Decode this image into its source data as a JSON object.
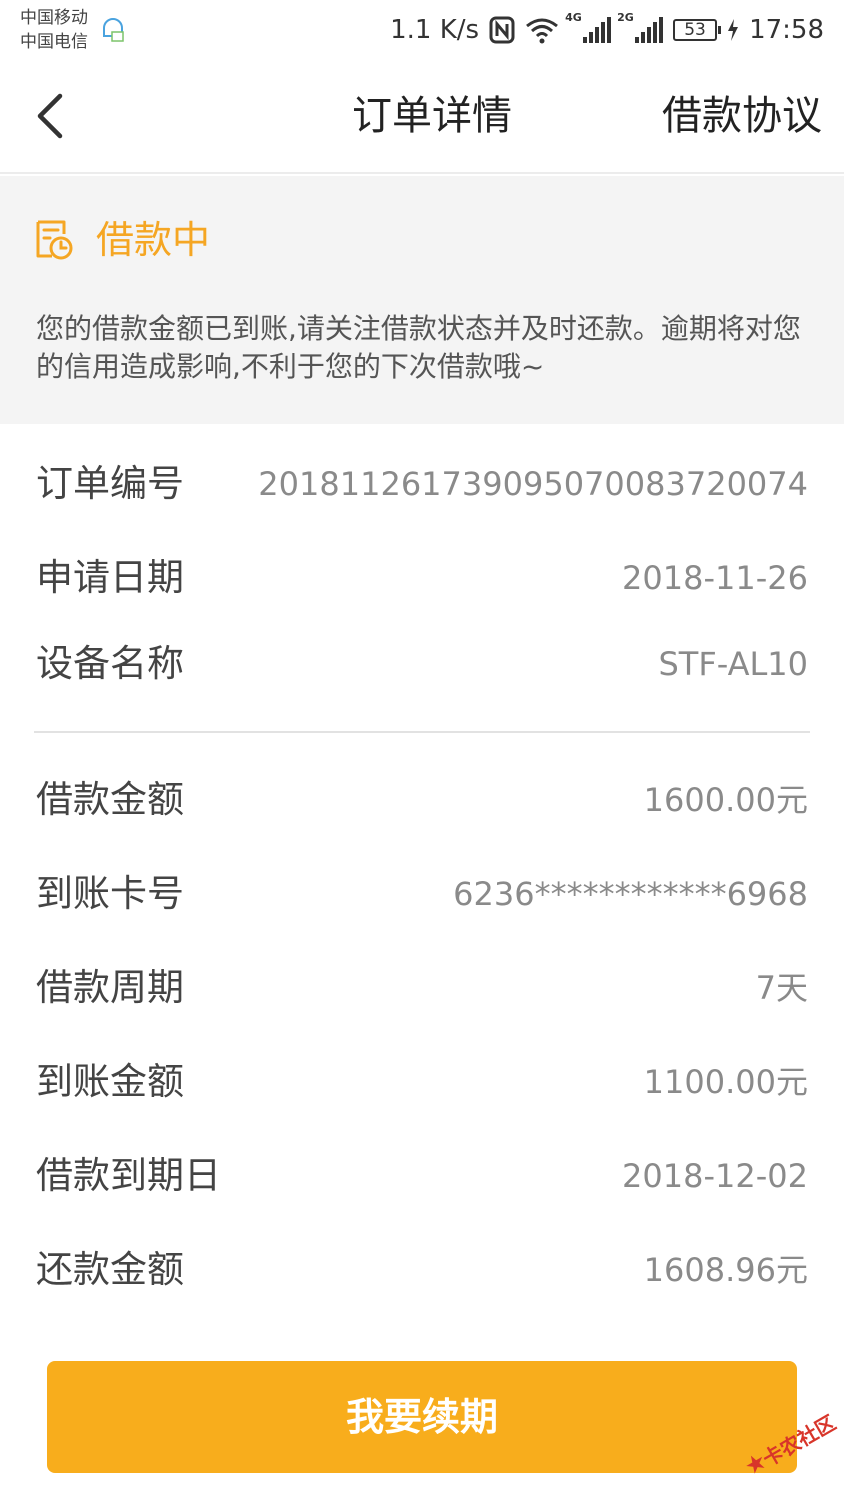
{
  "status_bar": {
    "carrier_1": "中国移动",
    "carrier_2": "中国电信",
    "net_speed": "1.1 K/s",
    "signal_1_tag": "4G",
    "signal_2_tag": "2G",
    "battery": "53",
    "time": "17:58"
  },
  "nav": {
    "title": "订单详情",
    "action": "借款协议"
  },
  "order_status": {
    "label": "借款中",
    "note": "您的借款金额已到账,请关注借款状态并及时还款。逾期将对您的信用造成影响,不利于您的下次借款哦~",
    "accent_color": "#f5a623"
  },
  "details": [
    {
      "label": "订单编号",
      "value": "20181126173909507008372007 4"
    },
    {
      "label": "申请日期",
      "value": "2018-11-26"
    },
    {
      "label": "设备名称",
      "value": "STF-AL10"
    }
  ],
  "loan": [
    {
      "label": "借款金额",
      "value": "1600.00元"
    },
    {
      "label": "到账卡号",
      "value": "6236************6968"
    },
    {
      "label": "借款周期",
      "value": "7天"
    },
    {
      "label": "到账金额",
      "value": "1100.00元"
    },
    {
      "label": "借款到期日",
      "value": "2018-12-02"
    },
    {
      "label": "还款金额",
      "value": "1608.96元"
    }
  ],
  "renew_button": {
    "label": "我要续期",
    "color": "#f8ad1c"
  },
  "watermark": {
    "text": "卡农社区"
  }
}
